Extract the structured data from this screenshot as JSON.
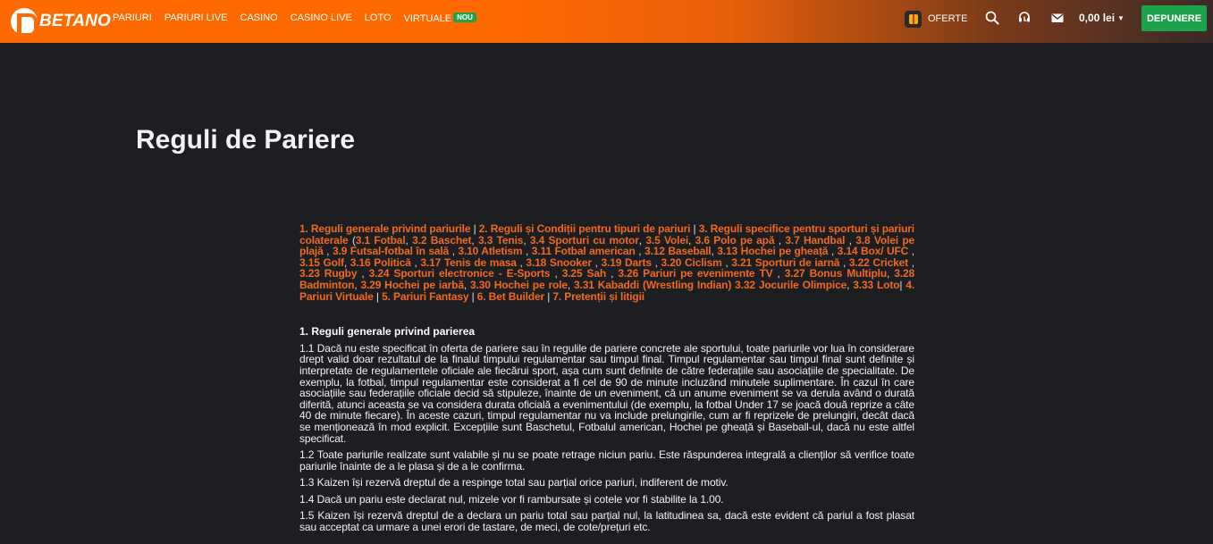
{
  "header": {
    "brand": "BETANO",
    "nav": [
      {
        "label": "PARIURI"
      },
      {
        "label": "PARIURI LIVE"
      },
      {
        "label": "CASINO"
      },
      {
        "label": "CASINO LIVE"
      },
      {
        "label": "LOTO"
      },
      {
        "label": "VIRTUALE",
        "badge": "NOU"
      }
    ],
    "oferte_label": "OFERTE",
    "balance": "0,00 lei",
    "deposit_label": "DEPUNERE",
    "icons": [
      "search-icon",
      "support-icon",
      "mail-icon"
    ],
    "colors": {
      "brand_orange": "#ff6a00",
      "deposit_green": "#1ea34d"
    }
  },
  "main": {
    "title": "Reguli de Pariere",
    "toc": [
      {
        "text": "1. Reguli generale privind pariurile",
        "after": " | "
      },
      {
        "text": "2. Reguli și Condiții pentru tipuri de pariuri",
        "after": " | "
      },
      {
        "text": "3. Reguli specifice pentru sporturi și pariuri colaterale",
        "after": " ("
      },
      {
        "text": "3.1 Fotbal",
        "after": ", "
      },
      {
        "text": "3.2 Baschet",
        "after": ", "
      },
      {
        "text": "3.3 Tenis",
        "after": ", "
      },
      {
        "text": "3.4 Sporturi cu motor",
        "after": ", "
      },
      {
        "text": "3.5 Volei",
        "after": ", "
      },
      {
        "text": "3.6 Polo pe apă",
        "after": " , "
      },
      {
        "text": "3.7 Handbal",
        "after": " , "
      },
      {
        "text": "3.8 Volei pe plajă",
        "after": " , "
      },
      {
        "text": "3.9 Futsal-fotbal în sală",
        "after": " , "
      },
      {
        "text": "3.10 Atletism",
        "after": " , "
      },
      {
        "text": "3.11 Fotbal american",
        "after": " , "
      },
      {
        "text": "3.12 Baseball",
        "after": ", "
      },
      {
        "text": "3.13 Hochei pe gheață",
        "after": " , "
      },
      {
        "text": "3.14 Box/ UFC",
        "after": " , "
      },
      {
        "text": "3.15 Golf",
        "after": ", "
      },
      {
        "text": "3.16 Politică",
        "after": " , "
      },
      {
        "text": "3.17 Tenis de masa",
        "after": " , "
      },
      {
        "text": "3.18 Snooker",
        "after": " , "
      },
      {
        "text": "3.19 Darts",
        "after": " , "
      },
      {
        "text": "3.20 Ciclism",
        "after": " , "
      },
      {
        "text": "3.21 Sporturi de iarnă",
        "after": " , "
      },
      {
        "text": "3.22 Cricket",
        "after": " , "
      },
      {
        "text": "3.23 Rugby",
        "after": " , "
      },
      {
        "text": "3.24 Sporturi electronice - E-Sports",
        "after": " , "
      },
      {
        "text": "3.25 Sah",
        "after": " , "
      },
      {
        "text": "3.26 Pariuri pe evenimente TV",
        "after": " , "
      },
      {
        "text": "3.27 Bonus Multiplu",
        "after": ", "
      },
      {
        "text": "3.28 Badminton",
        "after": ", "
      },
      {
        "text": "3.29 Hochei pe iarbă",
        "after": ", "
      },
      {
        "text": "3.30 Hochei pe role",
        "after": ", "
      },
      {
        "text": "3.31 Kabaddi (Wrestling Indian)",
        "after": " "
      },
      {
        "text": "3.32 Jocurile Olimpice",
        "after": ", "
      },
      {
        "text": "3.33 Loto",
        "after": "| "
      },
      {
        "text": "4. Pariuri Virtuale",
        "after": " | "
      },
      {
        "text": "5. Pariuri Fantasy",
        "after": "  | "
      },
      {
        "text": "6. Bet Builder",
        "after": " | "
      },
      {
        "text": "7. Pretenții și litigii",
        "after": ""
      }
    ],
    "section_heading": "1. Reguli generale privind parierea",
    "paragraphs": [
      "1.1 Dacă nu este specificat în oferta de pariere sau în regulile de pariere concrete ale sportului, toate pariurile vor lua în considerare drept valid doar rezultatul de la finalul timpului regulamentar sau timpul final. Timpul regulamentar  sau timpul final sunt definite și interpretate de regulamentele oficiale ale fiecărui sport, așa cum sunt definite de către federațiile sau asociațiile de specialitate. De exemplu, la fotbal, timpul regulamentar este considerat a fi cel de 90 de minute incluzând minutele suplimentare. În cazul în care asociațiile sau federațiile oficiale decid să stipuleze, înainte de un eveniment, că un anume eveniment se va derula având o durată diferită, atunci aceasta se va considera durata oficială a evenimentului (de exemplu, la fotbal Under 17 se joacă două reprize a câte 40 de minute fiecare). În aceste cazuri, timpul regulamentar nu va include prelungirile, cum ar fi reprizele de prelungiri, decât dacă se menționează în mod explicit. Excepțiile sunt Baschetul, Fotbalul american, Hochei pe gheață și Baseball-ul, dacă nu este altfel specificat.",
      "1.2 Toate pariurile realizate sunt valabile și nu se poate retrage niciun pariu. Este răspunderea integrală a clienților să verifice toate pariurile înainte de a le plasa și de a le confirma.",
      "1.3 Kaizen își rezervă dreptul de a respinge total sau parțial orice pariuri, indiferent de motiv.",
      "1.4 Dacă un pariu este declarat nul, mizele vor fi rambursate și cotele vor fi stabilite la 1.00.",
      "1.5 Kaizen își rezervă dreptul de a declara un pariu total sau parțial nul, la latitudinea sa, dacă este evident că pariul a fost plasat sau acceptat ca urmare a unei erori de tastare, de meci, de cote/prețuri etc."
    ]
  }
}
